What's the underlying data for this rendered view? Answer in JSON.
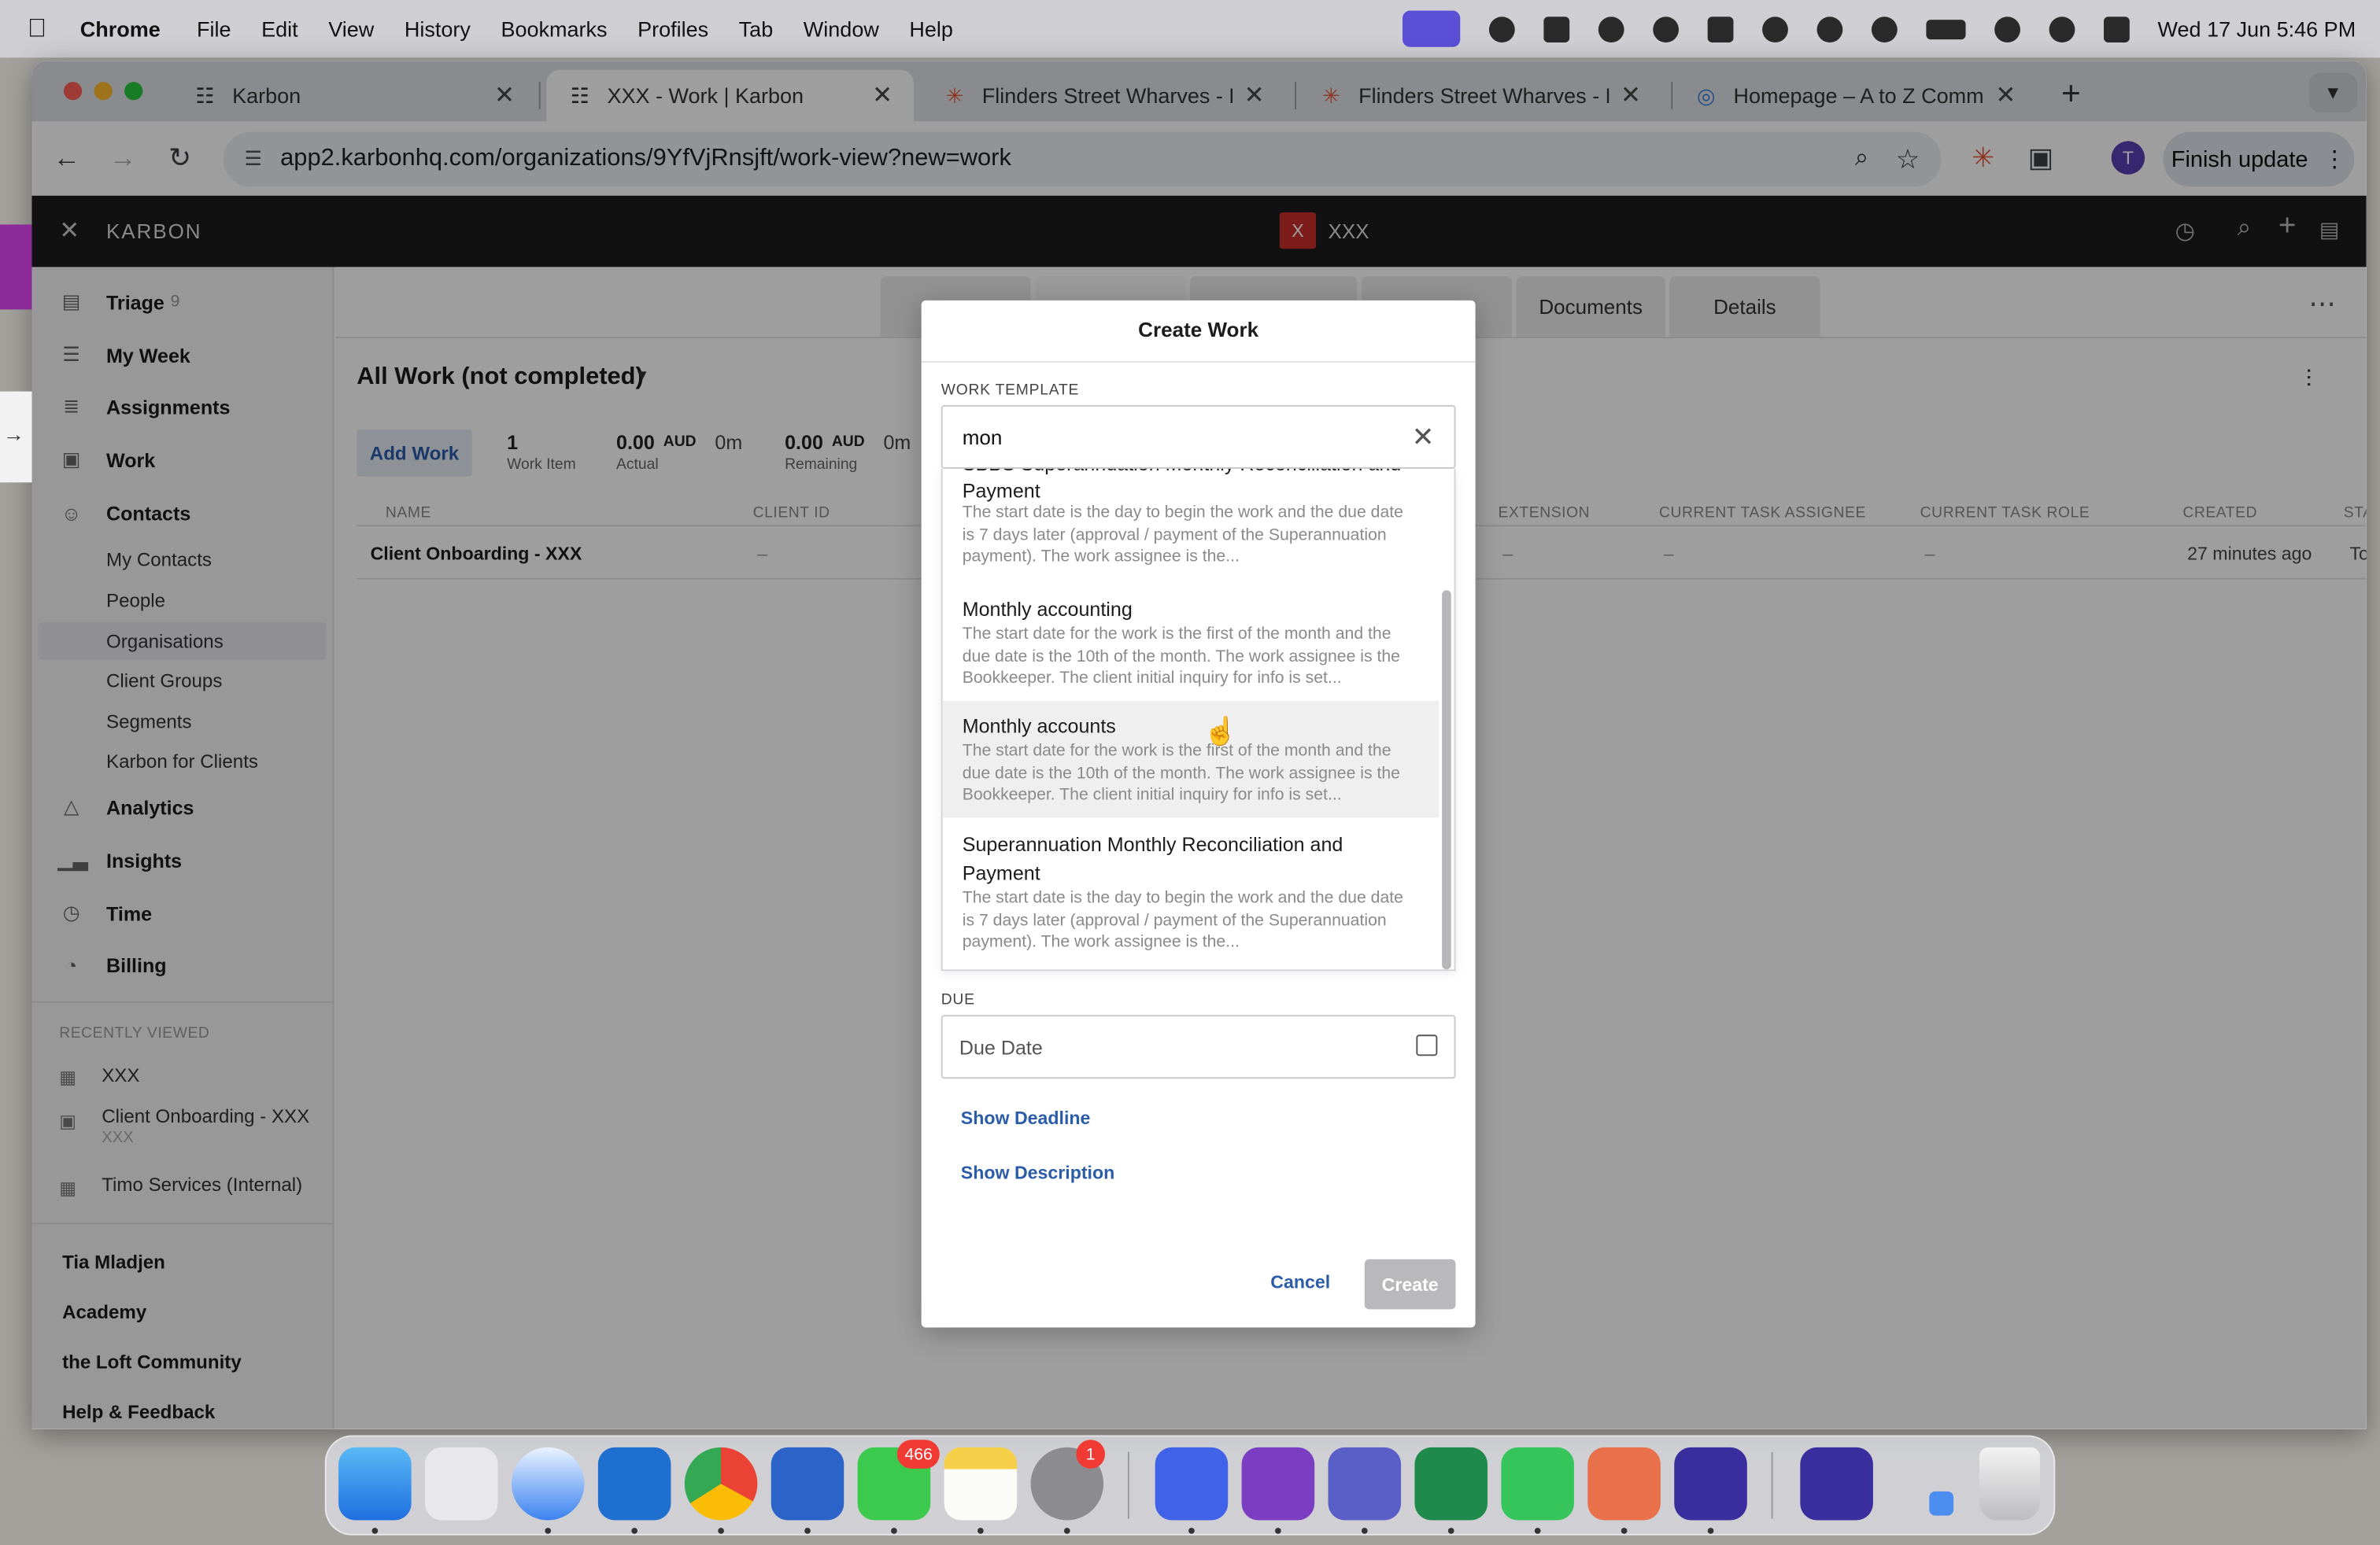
{
  "menubar": {
    "apple": "",
    "app_name": "Chrome",
    "items": [
      "File",
      "Edit",
      "View",
      "History",
      "Bookmarks",
      "Profiles",
      "Tab",
      "Window",
      "Help"
    ],
    "clock": "Wed 17 Jun  5:46 PM"
  },
  "browser": {
    "tabs": [
      {
        "title": "Karbon",
        "icon": "karbon-icon"
      },
      {
        "title": "XXX - Work | Karbon",
        "icon": "karbon-icon"
      },
      {
        "title": "Flinders Street Wharves - Pow",
        "icon": "asterisk-icon"
      },
      {
        "title": "Flinders Street Wharves - Pow",
        "icon": "asterisk-icon"
      },
      {
        "title": "Homepage – A to Z Comms &",
        "icon": "globe-icon"
      }
    ],
    "url": "app2.karbonhq.com/organizations/9YfVjRnsjft/work-view?new=work",
    "profile_initial": "T",
    "finish_update": "Finish update"
  },
  "karbon": {
    "brand": "KARBON",
    "org_initial": "X",
    "org_name": "XXX",
    "sidebar": {
      "nav": [
        {
          "label": "Triage",
          "count": "9",
          "icon": "triage-icon"
        },
        {
          "label": "My Week",
          "icon": "list-icon"
        },
        {
          "label": "Assignments",
          "icon": "assignments-icon"
        },
        {
          "label": "Work",
          "icon": "briefcase-icon"
        },
        {
          "label": "Contacts",
          "icon": "contacts-icon"
        }
      ],
      "contacts_sub": [
        "My Contacts",
        "People",
        "Organisations",
        "Client Groups",
        "Segments",
        "Karbon for Clients"
      ],
      "nav2": [
        {
          "label": "Analytics",
          "icon": "analytics-icon"
        },
        {
          "label": "Insights",
          "icon": "bar-chart-icon"
        },
        {
          "label": "Time",
          "icon": "clock-icon"
        },
        {
          "label": "Billing",
          "icon": "billing-icon"
        }
      ],
      "recently_viewed_heading": "RECENTLY VIEWED",
      "recent": [
        {
          "title": "XXX",
          "subtitle": ""
        },
        {
          "title": "Client Onboarding - XXX",
          "subtitle": "XXX"
        },
        {
          "title": "Timo Services (Internal)",
          "subtitle": ""
        }
      ],
      "footer": [
        "Tia Mladjen",
        "Academy",
        "the Loft Community",
        "Help & Feedback"
      ]
    },
    "main": {
      "tabs": [
        "Documents",
        "Details"
      ],
      "view_title": "All Work (not completed)",
      "add_work": "Add Work",
      "stats": [
        {
          "value": "1",
          "unit": "",
          "label": "Work Item"
        },
        {
          "value": "0.00",
          "unit": "AUD",
          "label": "Actual",
          "extra": "0m"
        },
        {
          "value": "0.00",
          "unit": "AUD",
          "label": "Remaining",
          "extra": "0m"
        }
      ],
      "columns": [
        "NAME",
        "CLIENT ID",
        "EXTENSION",
        "CURRENT TASK ASSIGNEE",
        "CURRENT TASK ROLE",
        "CREATED",
        "STA"
      ],
      "row": {
        "name": "Client Onboarding - XXX",
        "client_id": "–",
        "extension": "–",
        "assignee": "–",
        "role": "–",
        "created": "27 minutes ago",
        "status": "To"
      }
    }
  },
  "modal": {
    "title": "Create Work",
    "template_label": "WORK TEMPLATE",
    "template_value": "mon",
    "options": [
      {
        "title": "SBBS Superannuation Monthly Reconciliation and Payment",
        "desc": "The start date is the day to begin the work and the due date is 7 days later (approval / payment of the Superannuation payment). The work assignee is the..."
      },
      {
        "title": "Monthly accounting",
        "desc": "The start date for the work is the first of the month and the due date is the 10th of the month. The work assignee is the Bookkeeper. The client initial inquiry for info is set..."
      },
      {
        "title": "Monthly accounts",
        "desc": "The start date for the work is the first of the month and the due date is the 10th of the month. The work assignee is the Bookkeeper. The client initial inquiry for info is set..."
      },
      {
        "title": "Superannuation Monthly Reconciliation and Payment",
        "desc": "The start date is the day to begin the work and the due date is 7 days later (approval / payment of the Superannuation payment). The work assignee is the..."
      }
    ],
    "due_label": "DUE",
    "due_placeholder": "Due Date",
    "show_deadline": "Show Deadline",
    "show_description": "Show Description",
    "cancel": "Cancel",
    "create": "Create"
  },
  "dock": {
    "apps": [
      "finder",
      "launchpad",
      "safari",
      "outlook",
      "chrome",
      "word",
      "messages",
      "notes",
      "system-settings",
      "nordvpn",
      "onenote",
      "teams",
      "excel",
      "whatsapp",
      "claude",
      "grammarly",
      "grammarly-editor",
      "trash"
    ],
    "messages_badge": "466",
    "settings_badge": "1"
  },
  "colors": {
    "accent": "#2b5ca8",
    "topbar": "#1c1c1c",
    "org_badge": "#c9302c"
  }
}
